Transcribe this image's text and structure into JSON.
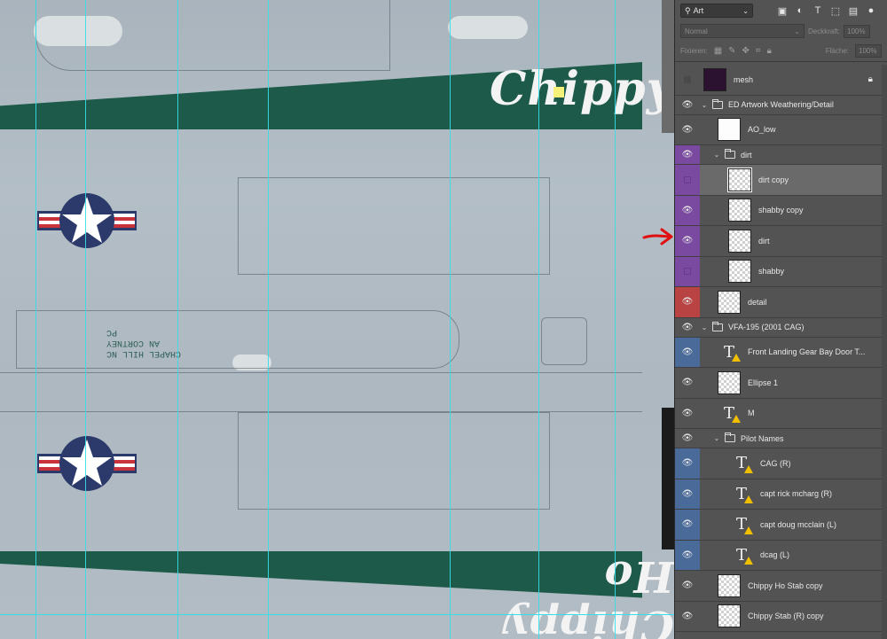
{
  "canvas": {
    "script_top": "Chippy",
    "script_bottom": "Chippy Ho",
    "stencil": [
      "CHAPEL HILL NC",
      "AN CORTNEY",
      "PC"
    ]
  },
  "panel": {
    "filter": "Art",
    "blend_mode": "Normal",
    "opacity_label": "Deckkraft:",
    "opacity_value": "100%",
    "lock_label": "Fixieren:",
    "fill_label": "Fläche:",
    "fill_value": "100%",
    "layers": [
      {
        "name": "mesh"
      },
      {
        "name": "ED Artwork Weathering/Detail"
      },
      {
        "name": "AO_low"
      },
      {
        "name": "dirt"
      },
      {
        "name": "dirt copy"
      },
      {
        "name": "shabby copy"
      },
      {
        "name": "dirt"
      },
      {
        "name": "shabby"
      },
      {
        "name": "detail"
      },
      {
        "name": "VFA-195 (2001 CAG)"
      },
      {
        "name": "Front Landing Gear Bay Door T..."
      },
      {
        "name": "Ellipse 1"
      },
      {
        "name": "M"
      },
      {
        "name": "Pilot Names"
      },
      {
        "name": "CAG (R)"
      },
      {
        "name": "capt rick mcharg (R)"
      },
      {
        "name": "capt doug mcclain (L)"
      },
      {
        "name": "dcag (L)"
      },
      {
        "name": "Chippy Ho Stab copy"
      },
      {
        "name": "Chippy Stab (R) copy"
      }
    ]
  },
  "colors": {
    "purple": "#7a4aa0",
    "red": "#b94242",
    "blue": "#4a6a9a",
    "stripe": "#1d5a4a"
  }
}
